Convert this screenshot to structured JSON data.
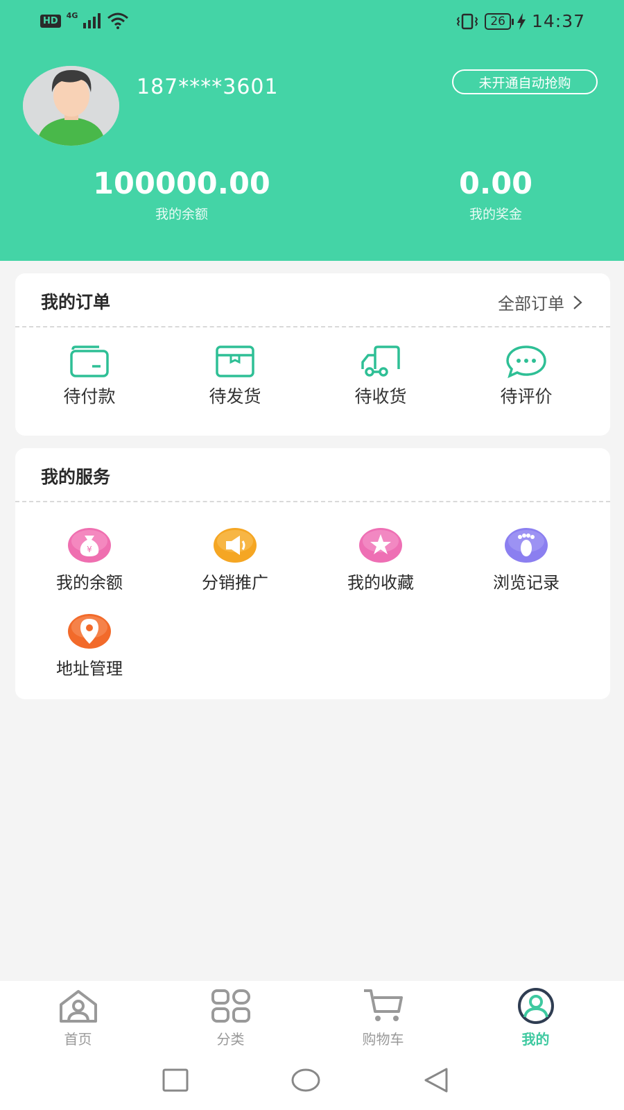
{
  "status_bar": {
    "left_badge": "HD",
    "network": "4G",
    "battery": "26",
    "time": "14:37"
  },
  "profile": {
    "phone": "187****3601",
    "auto_buy_label": "未开通自动抢购",
    "balance_value": "100000.00",
    "balance_label": "我的余额",
    "bonus_value": "0.00",
    "bonus_label": "我的奖金"
  },
  "orders": {
    "title": "我的订单",
    "all_label": "全部订单",
    "items": [
      {
        "label": "待付款",
        "icon": "wallet-icon"
      },
      {
        "label": "待发货",
        "icon": "box-icon"
      },
      {
        "label": "待收货",
        "icon": "truck-icon"
      },
      {
        "label": "待评价",
        "icon": "chat-bubble-icon"
      }
    ]
  },
  "services": {
    "title": "我的服务",
    "items": [
      {
        "label": "我的余额",
        "icon": "money-bag-icon"
      },
      {
        "label": "分销推广",
        "icon": "megaphone-icon"
      },
      {
        "label": "我的收藏",
        "icon": "star-icon"
      },
      {
        "label": "浏览记录",
        "icon": "footprint-icon"
      },
      {
        "label": "地址管理",
        "icon": "location-pin-icon"
      }
    ]
  },
  "tabs": [
    {
      "label": "首页",
      "icon": "home-icon"
    },
    {
      "label": "分类",
      "icon": "category-grid-icon"
    },
    {
      "label": "购物车",
      "icon": "cart-icon"
    },
    {
      "label": "我的",
      "icon": "user-icon",
      "active": true
    }
  ],
  "colors": {
    "brand": "#44d4a6",
    "icon_green": "#2ebf95",
    "active_tab": "#3ec9a0"
  }
}
